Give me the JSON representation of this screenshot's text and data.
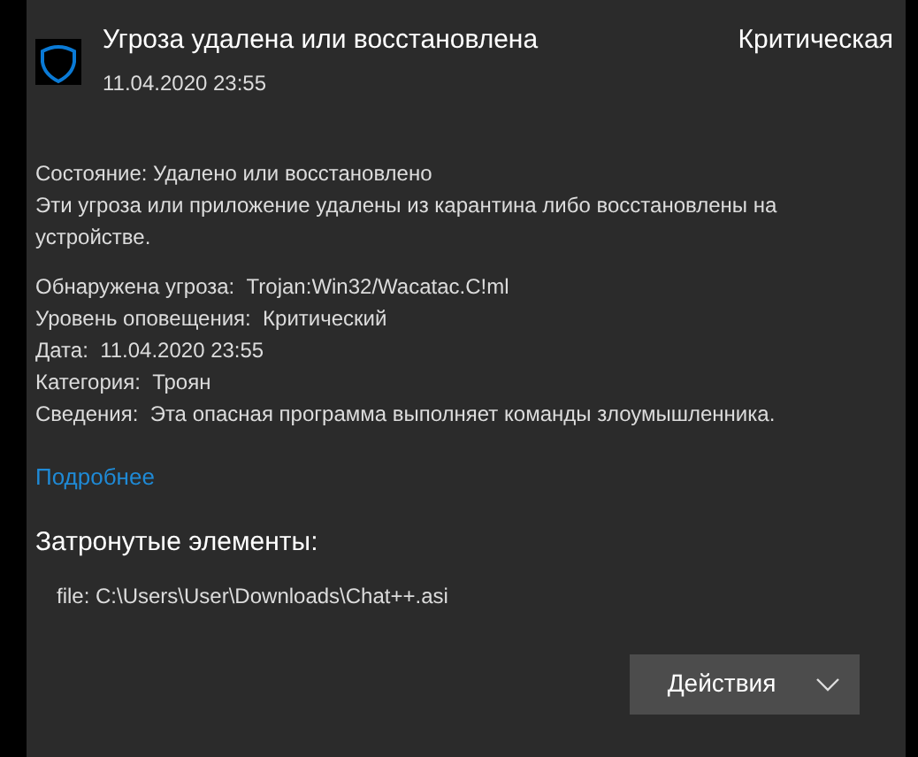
{
  "header": {
    "title": "Угроза удалена или восстановлена",
    "date": "11.04.2020 23:55",
    "severity": "Критическая"
  },
  "status": {
    "label": "Состояние:",
    "value": "Удалено или восстановлено"
  },
  "description": "Эти угроза или приложение удалены из карантина либо восстановлены на устройстве.",
  "details": [
    {
      "label": "Обнаружена угроза:",
      "value": "Trojan:Win32/Wacatac.C!ml"
    },
    {
      "label": "Уровень оповещения:",
      "value": "Критический"
    },
    {
      "label": "Дата:",
      "value": "11.04.2020 23:55"
    },
    {
      "label": "Категория:",
      "value": "Троян"
    },
    {
      "label": "Сведения:",
      "value": "Эта опасная программа выполняет команды злоумышленника."
    }
  ],
  "link": "Подробнее",
  "affected": {
    "title": "Затронутые элементы:",
    "items": [
      "file: C:\\Users\\User\\Downloads\\Chat++.asi"
    ]
  },
  "actions_button": "Действия"
}
